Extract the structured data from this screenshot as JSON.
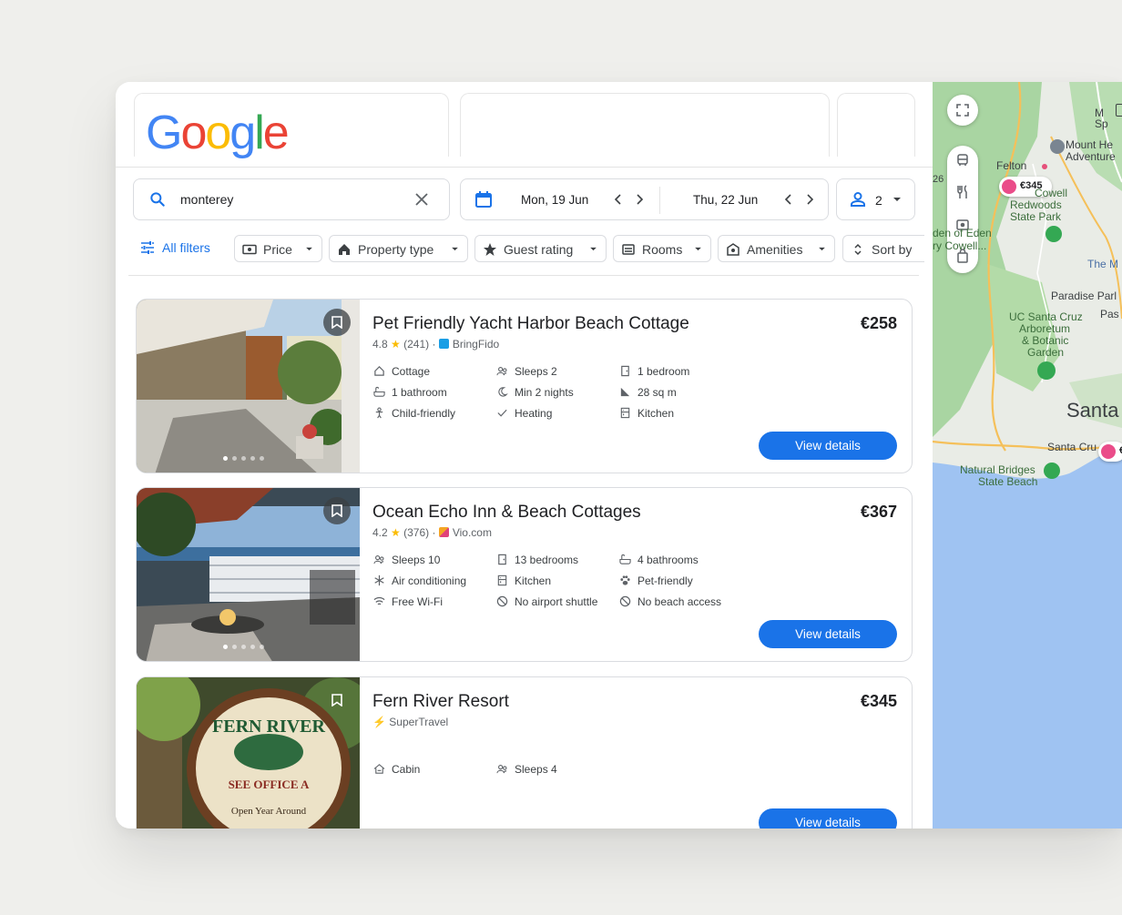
{
  "header": {
    "logo": [
      {
        "ch": "G",
        "color": "#4285F4"
      },
      {
        "ch": "o",
        "color": "#EA4335"
      },
      {
        "ch": "o",
        "color": "#FBBC05"
      },
      {
        "ch": "g",
        "color": "#4285F4"
      },
      {
        "ch": "l",
        "color": "#34A853"
      },
      {
        "ch": "e",
        "color": "#EA4335"
      }
    ]
  },
  "search": {
    "query": "monterey"
  },
  "dates": {
    "checkin": "Mon, 19 Jun",
    "checkout": "Thu, 22 Jun"
  },
  "guests": {
    "count": "2"
  },
  "filters": {
    "all": "All filters",
    "chips": [
      "Price",
      "Property type",
      "Guest rating",
      "Rooms",
      "Amenities",
      "Sort by"
    ]
  },
  "results": [
    {
      "title": "Pet Friendly Yacht Harbor Beach Cottage",
      "price": "€258",
      "rating": "4.8",
      "reviews": "(241)",
      "source": "BringFido",
      "amenities": [
        "Cottage",
        "Sleeps 2",
        "1 bedroom",
        "1 bathroom",
        "Min 2 nights",
        "28 sq m",
        "Child-friendly",
        "Heating",
        "Kitchen"
      ],
      "button": "View details"
    },
    {
      "title": "Ocean Echo Inn & Beach Cottages",
      "price": "€367",
      "rating": "4.2",
      "reviews": "(376)",
      "source": "Vio.com",
      "amenities": [
        "Sleeps 10",
        "13 bedrooms",
        "4 bathrooms",
        "Air conditioning",
        "Kitchen",
        "Pet-friendly",
        "Free Wi-Fi",
        "No airport shuttle",
        "No beach access"
      ],
      "button": "View details"
    },
    {
      "title": "Fern River Resort",
      "price": "€345",
      "source": "SuperTravel",
      "amenities": [
        "Cabin",
        "Sleeps 4"
      ],
      "button": "View details"
    }
  ],
  "map": {
    "labels": {
      "felton": "Felton",
      "pin_price": "€345",
      "pin_price2": "€",
      "mount_hermon_1": "Mount He",
      "mount_hermon_2": "Adventure",
      "m1": "M",
      "m2": "Sp",
      "num26": "26",
      "cowell_1": "Cowell",
      "redwoods_1": "Redwoods",
      "redwoods_2": "State Park",
      "eden_1": "den of Eden",
      "eden_2": "ry Cowell...",
      "the_m": "The M",
      "paradise": "Paradise Parl",
      "pas": "Pas",
      "ucsc_1": "UC Santa Cruz",
      "ucsc_2": "Arboretum",
      "ucsc_3": "& Botanic",
      "ucsc_4": "Garden",
      "santa": "Santa",
      "santa_cruz": "Santa Cru",
      "nb_1": "Natural Bridges",
      "nb_2": "State Beach"
    }
  }
}
